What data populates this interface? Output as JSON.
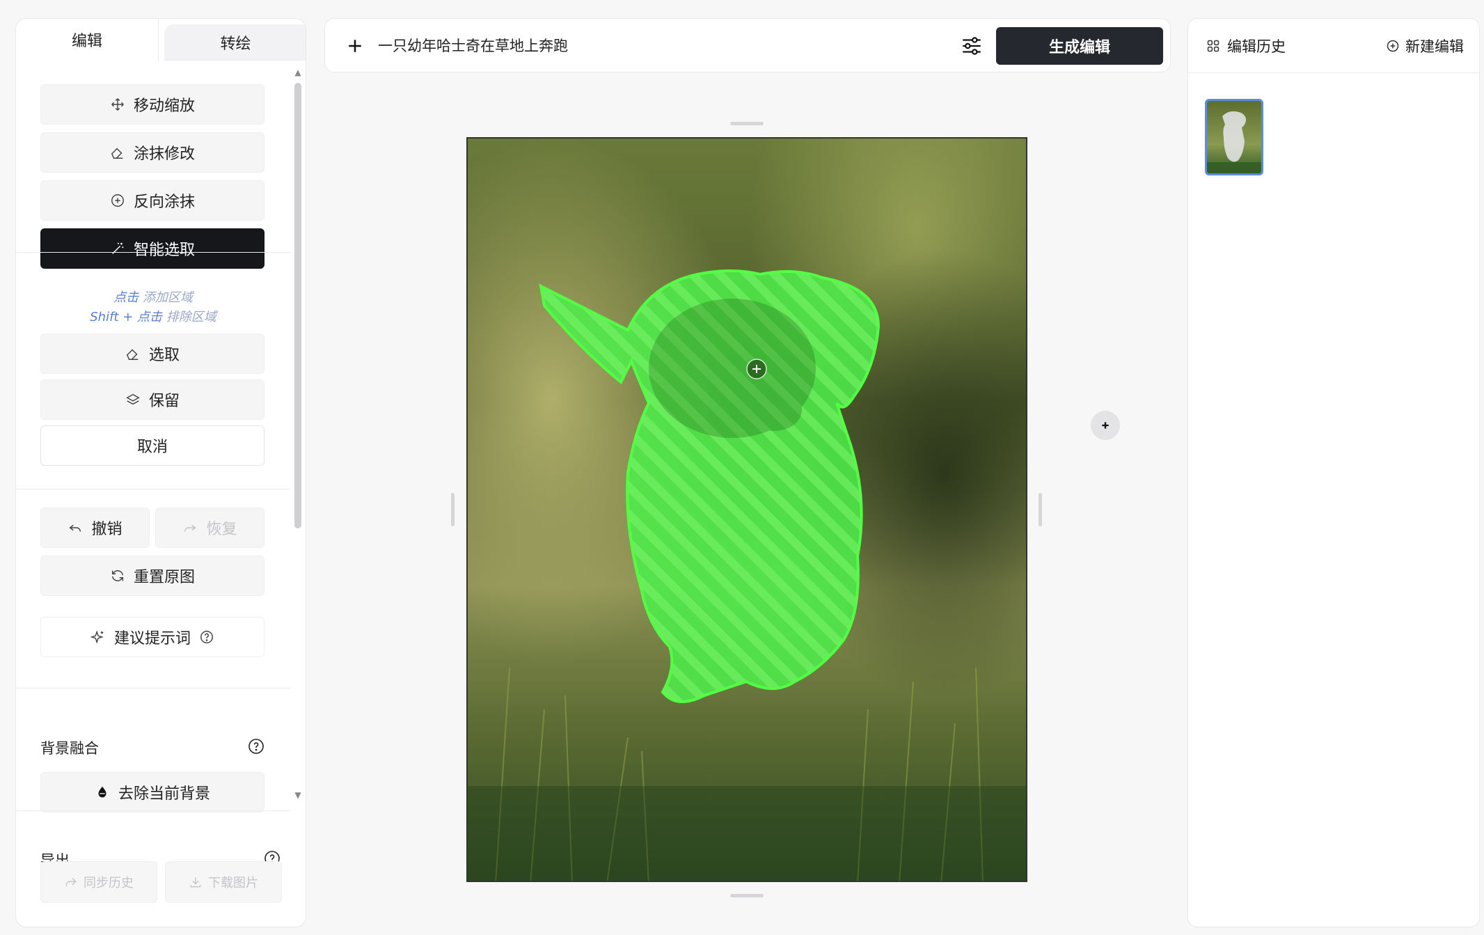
{
  "tabs": {
    "edit": "编辑",
    "redraw": "转绘"
  },
  "tools": {
    "move_zoom": "移动缩放",
    "brush": "涂抹修改",
    "inverse_brush": "反向涂抹",
    "smart_select": "智能选取"
  },
  "hint": {
    "click": "点击",
    "add_area": " 添加区域",
    "shift_click": "Shift + 点击",
    "exclude_area": " 排除区域"
  },
  "selection": {
    "select": "选取",
    "keep": "保留",
    "cancel": "取消"
  },
  "history_actions": {
    "undo": "撤销",
    "redo": "恢复",
    "reset": "重置原图"
  },
  "suggest": {
    "label": "建议提示词"
  },
  "background": {
    "title": "背景融合",
    "remove": "去除当前背景"
  },
  "export": {
    "title": "导出",
    "sync": "同步历史",
    "download": "下载图片"
  },
  "prompt": {
    "value": "一只幼年哈士奇在草地上奔跑"
  },
  "generate": {
    "label": "生成编辑"
  },
  "right_panel": {
    "history_title": "编辑历史",
    "new_edit": "新建编辑"
  },
  "colors": {
    "accent_dark": "#16171b",
    "mask_green": "#4cf04a",
    "thumb_border": "#5b8cde"
  }
}
